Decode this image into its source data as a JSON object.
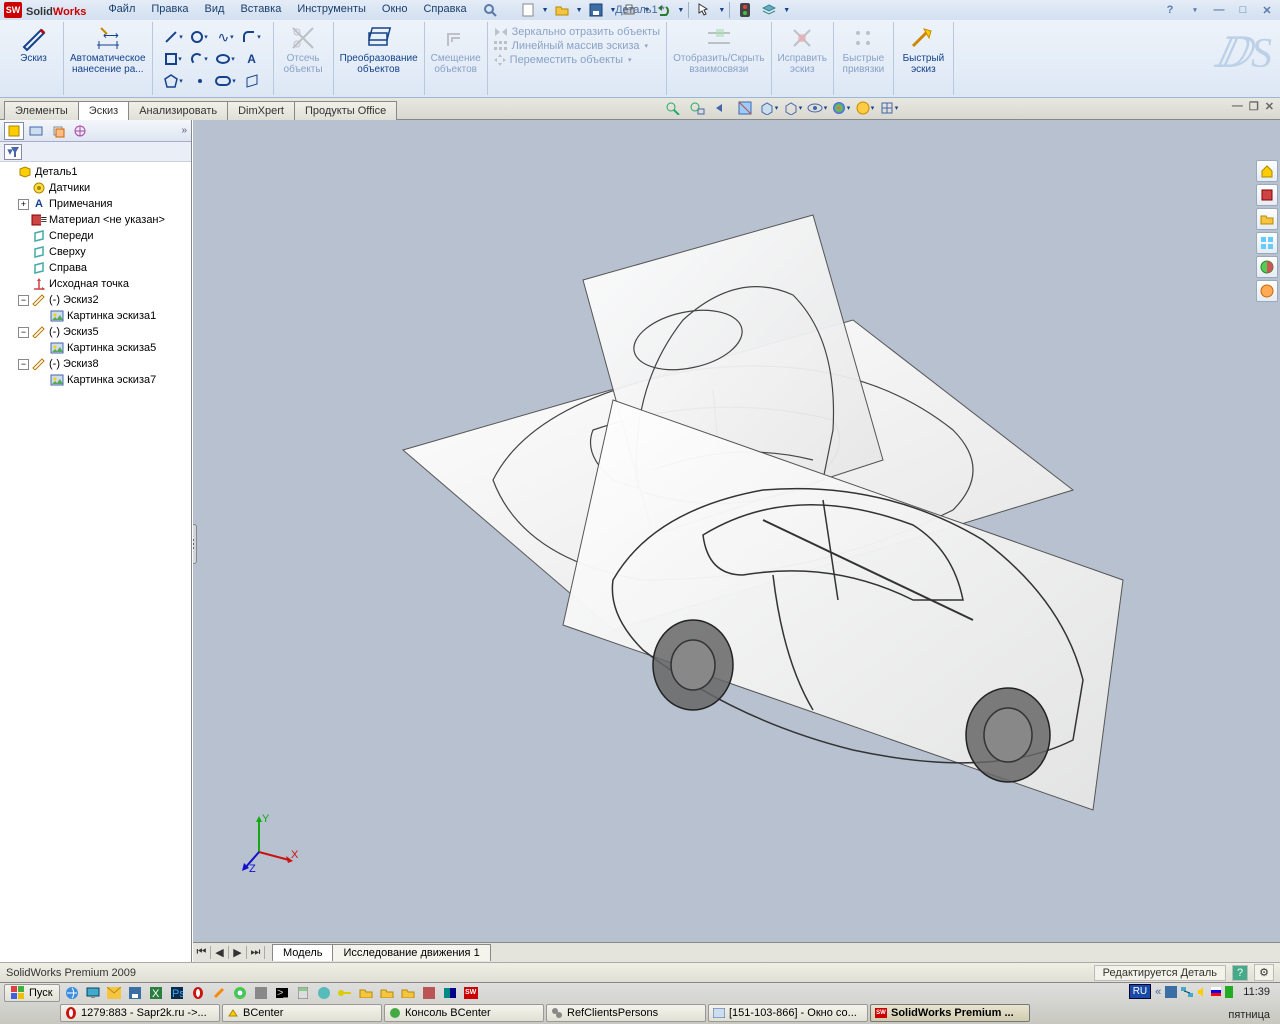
{
  "app": {
    "name": "SolidWorks",
    "document": "Деталь1 *"
  },
  "menu": [
    "Файл",
    "Правка",
    "Вид",
    "Вставка",
    "Инструменты",
    "Окно",
    "Справка"
  ],
  "ribbon": {
    "sketch": "Эскиз",
    "auto_dim": "Автоматическое\nнанесение ра...",
    "trim": "Отсечь\nобъекты",
    "convert": "Преобразование\nобъектов",
    "offset": "Смещение\nобъектов",
    "mirror": "Зеркально отразить объекты",
    "linear": "Линейный массив эскиза",
    "move": "Переместить объекты",
    "display_hide": "Отобразить/Скрыть\nвзаимосвязи",
    "repair": "Исправить\nэскиз",
    "quick_snaps": "Быстрые\nпривязки",
    "rapid_sketch": "Быстрый\nэскиз"
  },
  "tabs": [
    "Элементы",
    "Эскиз",
    "Анализировать",
    "DimXpert",
    "Продукты Office"
  ],
  "active_tab": "Эскиз",
  "tree": {
    "root": "Деталь1",
    "items": [
      "Датчики",
      "Примечания",
      "Материал <не указан>",
      "Спереди",
      "Сверху",
      "Справа",
      "Исходная точка",
      "(-) Эскиз2",
      "Картинка эскиза1",
      "(-) Эскиз5",
      "Картинка эскиза5",
      "(-) Эскиз8",
      "Картинка эскиза7"
    ]
  },
  "bottom_tabs": [
    "Модель",
    "Исследование движения 1"
  ],
  "status": {
    "left": "SolidWorks Premium 2009",
    "right": "Редактируется Деталь"
  },
  "taskbar": {
    "start": "Пуск",
    "tasks": [
      "1279:883 - Sapr2k.ru ->...",
      "BCenter",
      "Консоль BCenter",
      "RefClientsPersons",
      "[151-103-866] - Окно со...",
      "SolidWorks Premium ..."
    ],
    "lang": "RU",
    "time": "11:39",
    "day": "пятница"
  },
  "side_icons": [
    "home-icon",
    "part-icon",
    "folder-icon",
    "grid-icon",
    "refresh-icon",
    "options-icon"
  ],
  "triad_labels": {
    "x": "X",
    "y": "Y",
    "z": "Z"
  }
}
